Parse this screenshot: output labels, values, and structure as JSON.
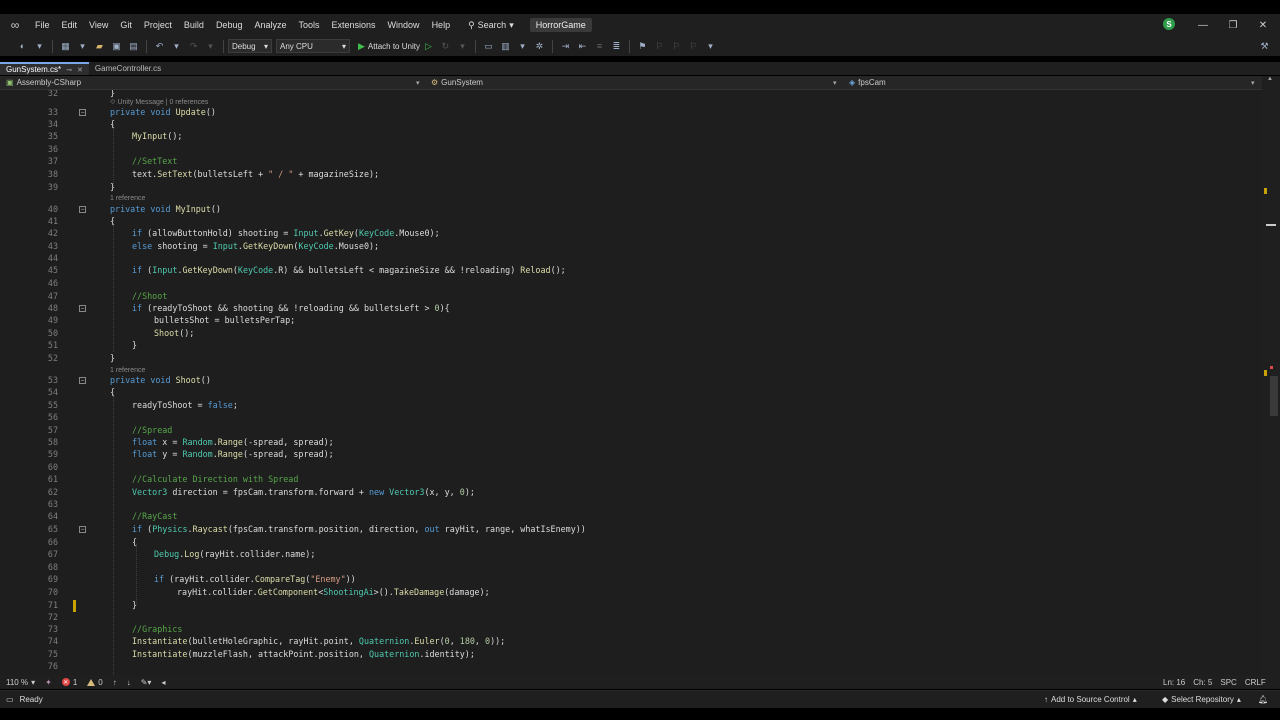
{
  "menu": {
    "items": [
      "File",
      "Edit",
      "View",
      "Git",
      "Project",
      "Build",
      "Debug",
      "Analyze",
      "Tools",
      "Extensions",
      "Window",
      "Help"
    ],
    "search_label": "Search",
    "project_name": "HorrorGame",
    "user_initial": "S"
  },
  "toolbar": {
    "configuration": "Debug",
    "platform": "Any CPU",
    "attach_label": "Attach to Unity"
  },
  "tabs": [
    {
      "label": "GunSystem.cs*",
      "active": true
    },
    {
      "label": "GameController.cs",
      "active": false
    }
  ],
  "navbar": {
    "project": "Assembly-CSharp",
    "class": "GunSystem",
    "member": "fpsCam"
  },
  "code": {
    "codelens": [
      {
        "text": "Unity Message | 0 references",
        "before_line": 33
      },
      {
        "text": "1 reference",
        "before_line": 40
      },
      {
        "text": "1 reference",
        "before_line": 53
      }
    ],
    "lines": [
      {
        "n": "32",
        "text": "}"
      },
      {
        "n": "33",
        "text": "private void Update()"
      },
      {
        "n": "34",
        "text": "{"
      },
      {
        "n": "35",
        "text": "MyInput();"
      },
      {
        "n": "36",
        "text": ""
      },
      {
        "n": "37",
        "text": "//SetText"
      },
      {
        "n": "38",
        "text": "text.SetText(bulletsLeft + \" / \" + magazineSize);"
      },
      {
        "n": "39",
        "text": "}"
      },
      {
        "n": "40",
        "text": "private void MyInput()"
      },
      {
        "n": "41",
        "text": "{"
      },
      {
        "n": "42",
        "text": "if (allowButtonHold) shooting = Input.GetKey(KeyCode.Mouse0);"
      },
      {
        "n": "43",
        "text": "else shooting = Input.GetKeyDown(KeyCode.Mouse0);"
      },
      {
        "n": "44",
        "text": ""
      },
      {
        "n": "45",
        "text": "if (Input.GetKeyDown(KeyCode.R) && bulletsLeft < magazineSize && !reloading) Reload();"
      },
      {
        "n": "46",
        "text": ""
      },
      {
        "n": "47",
        "text": "//Shoot"
      },
      {
        "n": "48",
        "text": "if (readyToShoot && shooting && !reloading && bulletsLeft > 0){"
      },
      {
        "n": "49",
        "text": "bulletsShot = bulletsPerTap;"
      },
      {
        "n": "50",
        "text": "Shoot();"
      },
      {
        "n": "51",
        "text": "}"
      },
      {
        "n": "52",
        "text": "}"
      },
      {
        "n": "53",
        "text": "private void Shoot()"
      },
      {
        "n": "54",
        "text": "{"
      },
      {
        "n": "55",
        "text": "readyToShoot = false;"
      },
      {
        "n": "56",
        "text": ""
      },
      {
        "n": "57",
        "text": "//Spread"
      },
      {
        "n": "58",
        "text": "float x = Random.Range(-spread, spread);"
      },
      {
        "n": "59",
        "text": "float y = Random.Range(-spread, spread);"
      },
      {
        "n": "60",
        "text": ""
      },
      {
        "n": "61",
        "text": "//Calculate Direction with Spread"
      },
      {
        "n": "62",
        "text": "Vector3 direction = fpsCam.transform.forward + new Vector3(x, y, 0);"
      },
      {
        "n": "63",
        "text": ""
      },
      {
        "n": "64",
        "text": "//RayCast"
      },
      {
        "n": "65",
        "text": "if (Physics.Raycast(fpsCam.transform.position, direction, out rayHit, range, whatIsEnemy))"
      },
      {
        "n": "66",
        "text": "{"
      },
      {
        "n": "67",
        "text": "Debug.Log(rayHit.collider.name);"
      },
      {
        "n": "68",
        "text": ""
      },
      {
        "n": "69",
        "text": "if (rayHit.collider.CompareTag(\"Enemy\"))"
      },
      {
        "n": "70",
        "text": "rayHit.collider.GetComponent<ShootingAi>().TakeDamage(damage);"
      },
      {
        "n": "71",
        "text": "}"
      },
      {
        "n": "72",
        "text": ""
      },
      {
        "n": "73",
        "text": "//Graphics"
      },
      {
        "n": "74",
        "text": "Instantiate(bulletHoleGraphic, rayHit.point, Quaternion.Euler(0, 180, 0));"
      },
      {
        "n": "75",
        "text": "Instantiate(muzzleFlash, attackPoint.position, Quaternion.identity);"
      },
      {
        "n": "76",
        "text": ""
      }
    ]
  },
  "editor_bottom": {
    "zoom": "110 %",
    "errors": "1",
    "warnings": "0",
    "ln": "Ln: 16",
    "ch": "Ch: 5",
    "spc": "SPC",
    "eol": "CRLF"
  },
  "status": {
    "ready": "Ready",
    "source_control": "Add to Source Control",
    "repository": "Select Repository"
  },
  "colors": {
    "keyword": "#569cd6",
    "type": "#4ec9b0",
    "string": "#d69d85",
    "comment": "#57a64a",
    "method": "#dcdcaa",
    "number": "#b5cea8"
  }
}
